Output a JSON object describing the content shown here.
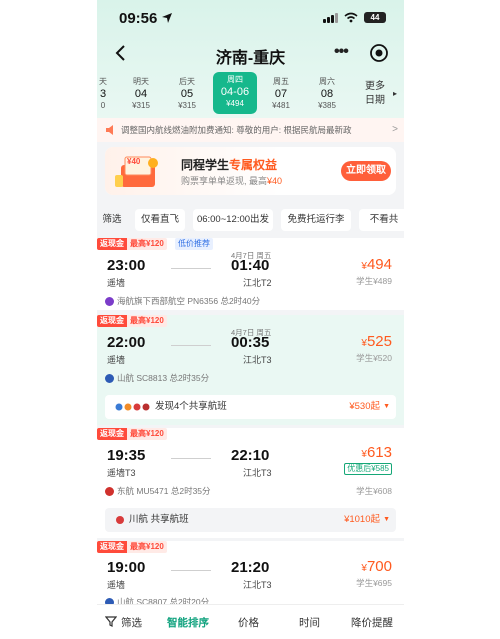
{
  "status": {
    "time": "09:56",
    "battery": "44"
  },
  "nav": {
    "title": "济南-重庆",
    "more_icon": "more-dots-icon",
    "target_icon": "target-icon"
  },
  "dates": [
    {
      "weekday": "天",
      "day": "3",
      "price": "0"
    },
    {
      "weekday": "明天",
      "day": "04",
      "price": "¥315"
    },
    {
      "weekday": "后天",
      "day": "05",
      "price": "¥315"
    },
    {
      "weekday": "周四",
      "day": "04-06",
      "price": "¥494",
      "active": true
    },
    {
      "weekday": "周五",
      "day": "07",
      "price": "¥481"
    },
    {
      "weekday": "周六",
      "day": "08",
      "price": "¥385"
    }
  ],
  "more_dates": {
    "line1": "更多",
    "line2": "日期"
  },
  "notice": {
    "text": "调整国内航线燃油附加费通知: 尊敬的用户: 根据民航局最新政"
  },
  "promo": {
    "title_prefix": "同程学生",
    "title_highlight": "专属权益",
    "sub_prefix": "购票享单单返现, 最高",
    "sub_highlight": "¥40",
    "gift_label": "¥40",
    "button": "立即领取"
  },
  "filters": [
    "筛选",
    "仅看直飞",
    "06:00~12:00出发",
    "免费托运行李",
    "不看共"
  ],
  "flights": [
    {
      "cash_tag": "返现金",
      "cash_amount": "最高¥120",
      "low_tag": "低价推荐",
      "dep_time": "23:00",
      "dep_airport": "遥墙",
      "arr_date": "4月7日 周五",
      "arr_time": "01:40",
      "arr_airport": "江北T2",
      "price_symbol": "¥",
      "price": "494",
      "student": "学生¥489",
      "airline": "海航旗下西部航空 PN6356 总2时40分"
    },
    {
      "cash_tag": "返现金",
      "cash_amount": "最高¥120",
      "dep_time": "22:00",
      "dep_airport": "遥墙",
      "arr_date": "4月7日 周五",
      "arr_time": "00:35",
      "arr_airport": "江北T3",
      "price_symbol": "¥",
      "price": "525",
      "student": "学生¥520",
      "airline": "山航 SC8813 总2时35分",
      "share_label": "发现4个共享航班",
      "share_price": "¥530起"
    },
    {
      "cash_tag": "返现金",
      "cash_amount": "最高¥120",
      "dep_time": "19:35",
      "dep_airport": "遥墙T3",
      "arr_time": "22:10",
      "arr_airport": "江北T3",
      "price_symbol": "¥",
      "price": "613",
      "discount": "优惠后¥585",
      "student": "学生¥608",
      "airline": "东航 MU5471 总2时35分",
      "share_label": "川航 共享航班",
      "share_price": "¥1010起"
    },
    {
      "cash_tag": "返现金",
      "cash_amount": "最高¥120",
      "dep_time": "19:00",
      "dep_airport": "遥墙",
      "arr_time": "21:20",
      "arr_airport": "江北T3",
      "price_symbol": "¥",
      "price": "700",
      "student": "学生¥695",
      "airline": "山航 SC8807 总2时20分"
    }
  ],
  "bottom_bar": {
    "filter": "筛选",
    "smart_sort": "智能排序",
    "price": "价格",
    "time": "时间",
    "price_alert": "降价提醒"
  },
  "colors": {
    "accent": "#16b88c",
    "price": "#ff5a1f",
    "cash": "#ff4b3b",
    "link": "#2f6fe4"
  }
}
